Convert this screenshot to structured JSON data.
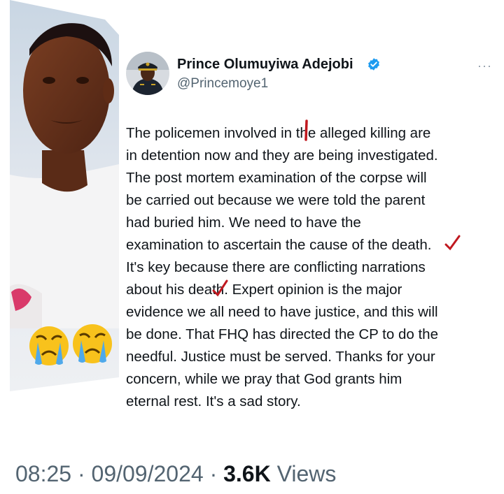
{
  "tweet": {
    "author_name": "Prince Olumuyiwa Adejobi",
    "handle": "@Princemoye1",
    "more_label": "···",
    "lines": [
      "The policemen involved in the alleged killing are",
      "in detention now and they are being investigated.",
      "The post mortem examination of the corpse will",
      "be carried out because we were told the parent",
      "had buried him. We need to have the",
      "examination to ascertain the cause of the death.",
      "It's key because there are conflicting narrations",
      "about his death. Expert opinion is the major",
      "evidence we all need to have justice, and this will",
      "be done. That FHQ has directed the CP to do the",
      "needful. Justice must be served. Thanks for your",
      "concern, while we pray that God grants him",
      "eternal rest. It's a sad story."
    ],
    "time": "08:25",
    "separator": "·",
    "date": "09/09/2024",
    "views_count": "3.6K",
    "views_label": "Views"
  },
  "icons": {
    "verified": "verified-badge-icon",
    "more": "more-options-icon"
  },
  "colors": {
    "verified": "#1d9bf0",
    "text": "#0f1419",
    "secondary": "#536471",
    "red_mark": "#c0181f"
  }
}
